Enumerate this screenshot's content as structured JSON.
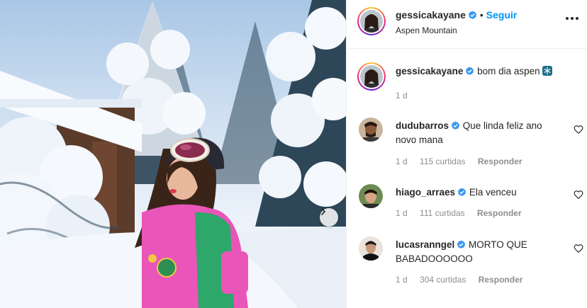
{
  "post": {
    "author": "gessicakayane",
    "location": "Aspen Mountain",
    "follow_label": "Seguir",
    "separator": "•",
    "caption": "bom dia aspen",
    "caption_emoji": "snowflake-icon",
    "caption_time": "1 d"
  },
  "comments": [
    {
      "user": "dudubarros",
      "text": "Que linda feliz ano novo mana",
      "time": "1 d",
      "likes": "115 curtidas",
      "reply": "Responder"
    },
    {
      "user": "hiago_arraes",
      "text": "Ela venceu",
      "time": "1 d",
      "likes": "111 curtidas",
      "reply": "Responder"
    },
    {
      "user": "lucasranngel",
      "text": "MORTO QUE BABADOOOOOO",
      "time": "1 d",
      "likes": "304 curtidas",
      "reply": "Responder"
    }
  ],
  "colors": {
    "link": "#0095f6",
    "verified": "#3897f0",
    "muted": "#8e8e8e",
    "text": "#262626"
  }
}
